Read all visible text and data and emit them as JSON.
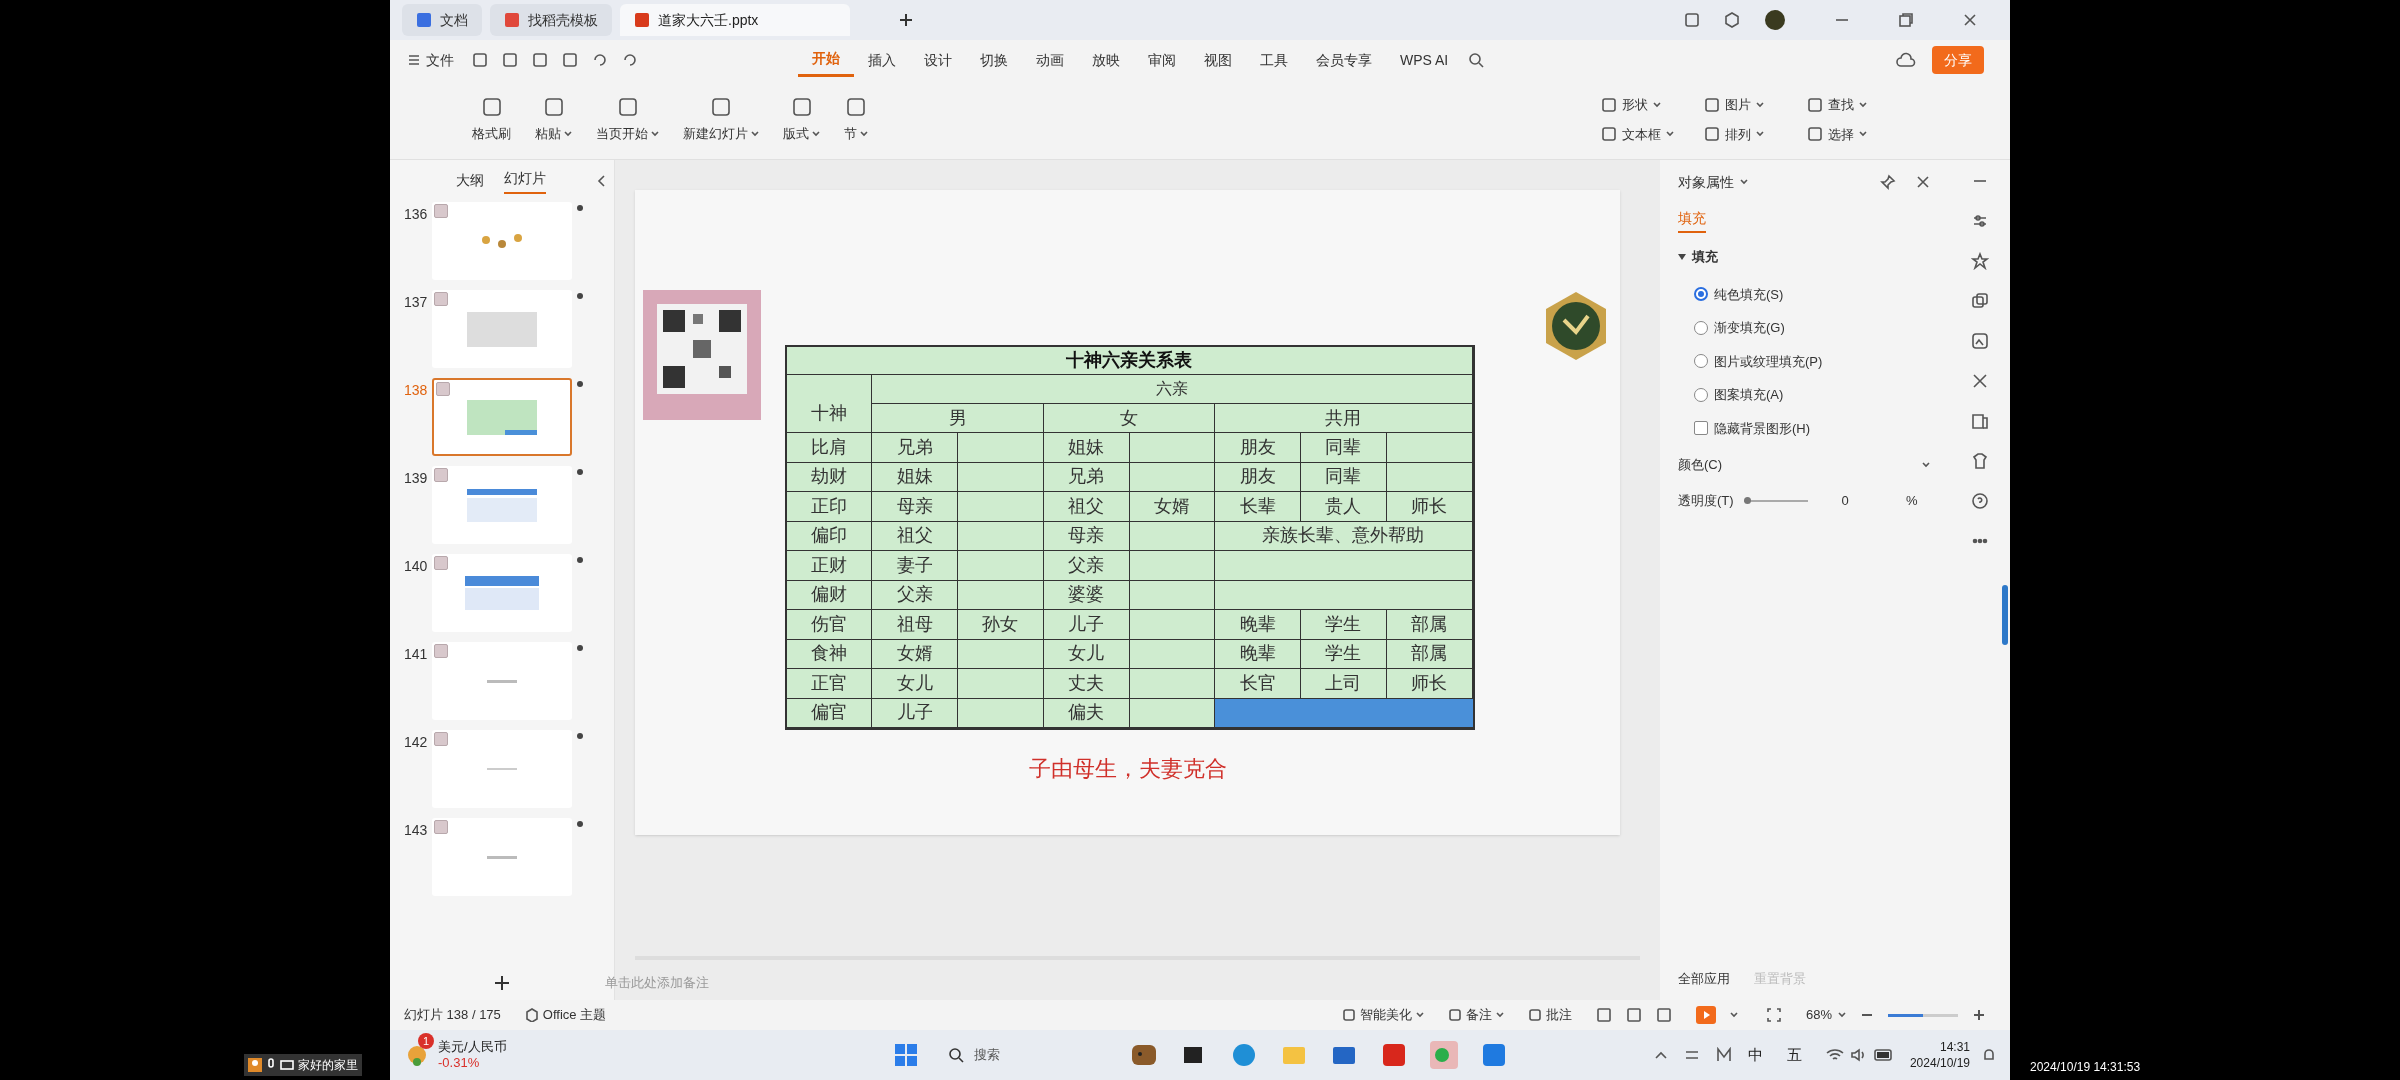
{
  "title_bar": {
    "tabs": [
      {
        "label": "文档",
        "selected": false
      },
      {
        "label": "找稻壳模板",
        "selected": false
      },
      {
        "label": "道家大六壬.pptx",
        "selected": true
      }
    ]
  },
  "menu": {
    "file": "文件",
    "tabs": [
      {
        "label": "开始",
        "selected": true
      },
      {
        "label": "插入",
        "selected": false
      },
      {
        "label": "设计",
        "selected": false
      },
      {
        "label": "切换",
        "selected": false
      },
      {
        "label": "动画",
        "selected": false
      },
      {
        "label": "放映",
        "selected": false
      },
      {
        "label": "审阅",
        "selected": false
      },
      {
        "label": "视图",
        "selected": false
      },
      {
        "label": "工具",
        "selected": false
      },
      {
        "label": "会员专享",
        "selected": false
      },
      {
        "label": "WPS AI",
        "selected": false
      }
    ],
    "share": "分享"
  },
  "ribbon": {
    "left": [
      {
        "label": "格式刷",
        "dropdown": false
      },
      {
        "label": "粘贴",
        "dropdown": true
      },
      {
        "label": "当页开始",
        "dropdown": true
      },
      {
        "label": "新建幻灯片",
        "dropdown": true
      },
      {
        "label": "版式",
        "dropdown": true
      },
      {
        "label": "节",
        "dropdown": true
      }
    ],
    "right": [
      {
        "label": "形状",
        "dropdown": true
      },
      {
        "label": "图片",
        "dropdown": true
      },
      {
        "label": "查找",
        "dropdown": true
      },
      {
        "label": "文本框",
        "dropdown": true
      },
      {
        "label": "排列",
        "dropdown": true
      },
      {
        "label": "选择",
        "dropdown": true
      }
    ]
  },
  "slides_panel": {
    "tabs": [
      {
        "label": "大纲",
        "selected": false
      },
      {
        "label": "幻灯片",
        "selected": true
      }
    ],
    "slides": [
      {
        "number": "136",
        "selected": false
      },
      {
        "number": "137",
        "selected": false
      },
      {
        "number": "138",
        "selected": true
      },
      {
        "number": "139",
        "selected": false
      },
      {
        "number": "140",
        "selected": false
      },
      {
        "number": "141",
        "selected": false
      },
      {
        "number": "142",
        "selected": false
      },
      {
        "number": "143",
        "selected": false
      }
    ]
  },
  "slide": {
    "table": {
      "title": "十神六亲关系表",
      "corner": "十神",
      "group": "六亲",
      "column_groups": [
        "男",
        "女",
        "共用"
      ],
      "rows": [
        {
          "kind": "split",
          "cells": [
            "比肩",
            "兄弟",
            null,
            "姐妹",
            null,
            "朋友",
            "同辈",
            null
          ]
        },
        {
          "kind": "split",
          "cells": [
            "劫财",
            "姐妹",
            null,
            "兄弟",
            null,
            "朋友",
            "同辈",
            null
          ]
        },
        {
          "kind": "split",
          "cells": [
            "正印",
            "母亲",
            null,
            "祖父",
            "女婿",
            "长辈",
            "贵人",
            "师长"
          ]
        },
        {
          "kind": "merged",
          "cells": [
            "偏印",
            "祖父",
            null,
            "母亲",
            null
          ],
          "common": "亲族长辈、意外帮助"
        },
        {
          "kind": "merged",
          "cells": [
            "正财",
            "妻子",
            null,
            "父亲",
            null
          ]
        },
        {
          "kind": "merged",
          "cells": [
            "偏财",
            "父亲",
            null,
            "婆婆",
            null
          ]
        },
        {
          "kind": "split",
          "cells": [
            "伤官",
            "祖母",
            "孙女",
            "儿子",
            null,
            "晚辈",
            "学生",
            "部属"
          ]
        },
        {
          "kind": "split",
          "cells": [
            "食神",
            "女婿",
            null,
            "女儿",
            null,
            "晚辈",
            "学生",
            "部属"
          ]
        },
        {
          "kind": "split",
          "cells": [
            "正官",
            "女儿",
            null,
            "丈夫",
            null,
            "长官",
            "上司",
            "师长"
          ]
        },
        {
          "kind": "selected",
          "cells": [
            "偏官",
            "儿子",
            null,
            "偏夫",
            null
          ]
        }
      ]
    },
    "caption": "子由母生，夫妻克合"
  },
  "notes_placeholder": "单击此处添加备注",
  "properties_panel": {
    "title": "对象属性",
    "tab": "填充",
    "section": "填充",
    "options": [
      {
        "kind": "radio",
        "label": "纯色填充(S)",
        "checked": true
      },
      {
        "kind": "radio",
        "label": "渐变填充(G)",
        "checked": false
      },
      {
        "kind": "radio",
        "label": "图片或纹理填充(P)",
        "checked": false
      },
      {
        "kind": "radio",
        "label": "图案填充(A)",
        "checked": false
      },
      {
        "kind": "checkbox",
        "label": "隐藏背景图形(H)",
        "checked": false
      }
    ],
    "color_label": "颜色(C)",
    "transparency_label": "透明度(T)",
    "transparency": {
      "level": 0,
      "value": "0",
      "unit": "%"
    },
    "apply_all": "全部应用",
    "reset": "重置背景"
  },
  "status_bar": {
    "slide_count": "幻灯片 138 / 175",
    "theme": "Office 主题",
    "beautify": "智能美化",
    "notes": "备注",
    "comments": "批注",
    "zoom": "68%",
    "zoom_slider": {
      "level": 0.5
    }
  },
  "taskbar": {
    "widget_badge": "1",
    "widget_title": "美元/人民币",
    "widget_change": "-0.31%",
    "search": "搜索",
    "ime_lang": "中",
    "ime_mode": "五",
    "time": "14:31",
    "date": "2024/10/19"
  },
  "overlay": {
    "caller": "家好的家里",
    "timestamp": "2024/10/19 14:31:53"
  }
}
